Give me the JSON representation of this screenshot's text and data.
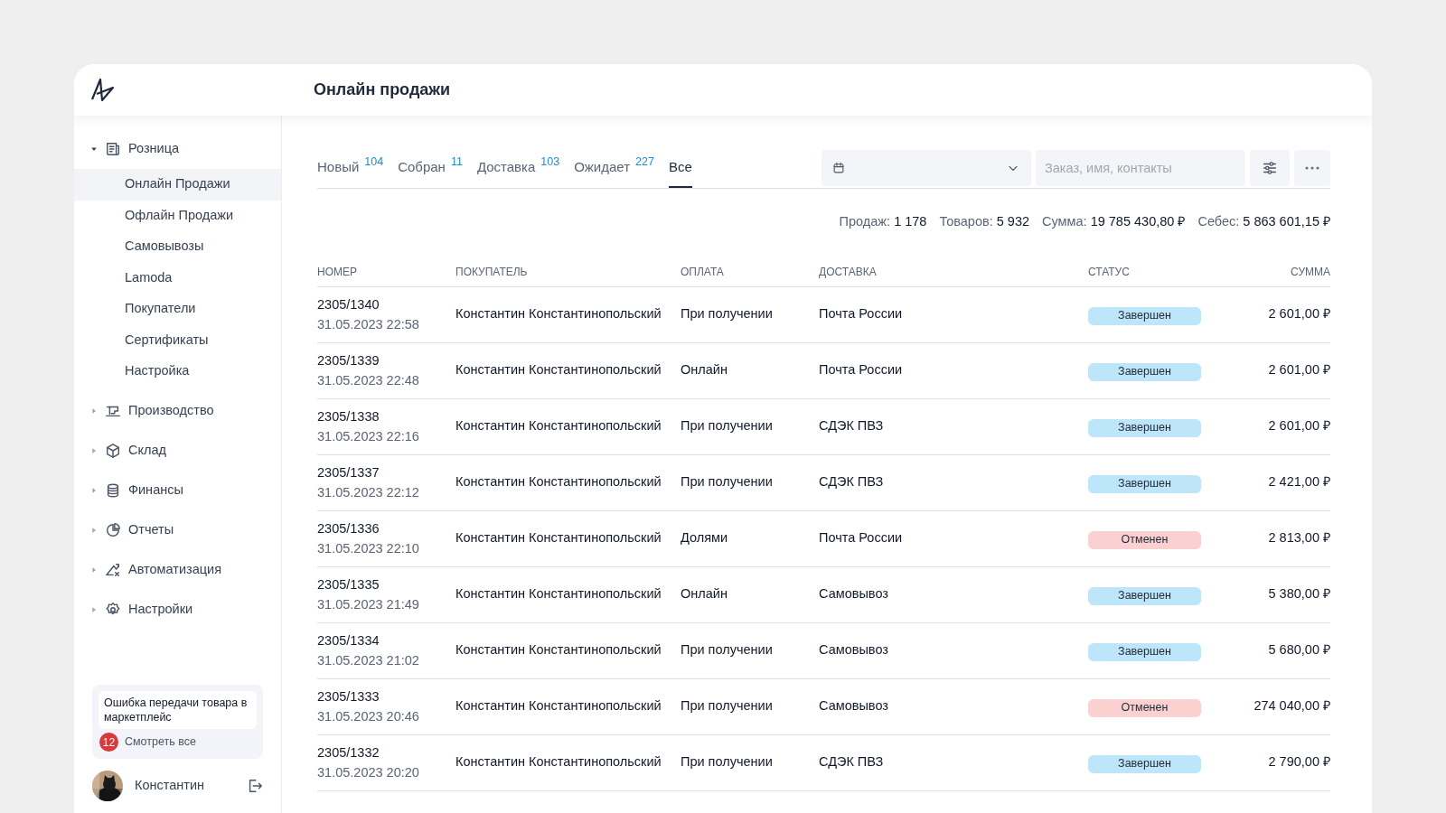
{
  "header": {
    "title": "Онлайн продажи"
  },
  "sidebar": {
    "items": [
      {
        "label": "Розница",
        "expanded": true,
        "children": [
          {
            "label": "Онлайн Продажи",
            "selected": true
          },
          {
            "label": "Офлайн Продажи",
            "selected": false
          },
          {
            "label": "Самовывозы",
            "selected": false
          },
          {
            "label": "Lamoda",
            "selected": false
          },
          {
            "label": "Покупатели",
            "selected": false
          },
          {
            "label": "Сертификаты",
            "selected": false
          },
          {
            "label": "Настройка",
            "selected": false
          }
        ]
      },
      {
        "label": "Производство",
        "expanded": false
      },
      {
        "label": "Склад",
        "expanded": false
      },
      {
        "label": "Финансы",
        "expanded": false
      },
      {
        "label": "Отчеты",
        "expanded": false
      },
      {
        "label": "Автоматизация",
        "expanded": false
      },
      {
        "label": "Настройки",
        "expanded": false
      }
    ],
    "notice": {
      "text": "Ошибка передачи товара в маркетплейс",
      "count": "12",
      "link": "Смотреть все"
    },
    "user": {
      "name": "Константин"
    }
  },
  "tabs": [
    {
      "label": "Новый",
      "count": "104",
      "selected": false
    },
    {
      "label": "Собран",
      "count": "11",
      "selected": false
    },
    {
      "label": "Доставка",
      "count": "103",
      "selected": false
    },
    {
      "label": "Ожидает",
      "count": "227",
      "selected": false
    },
    {
      "label": "Все",
      "selected": true
    }
  ],
  "search": {
    "placeholder": "Заказ, имя, контакты"
  },
  "summary": [
    {
      "label": "Продаж:",
      "value": "1 178"
    },
    {
      "label": "Товаров:",
      "value": "5 932"
    },
    {
      "label": "Сумма:",
      "value": "19 785 430,80 ₽"
    },
    {
      "label": "Себес:",
      "value": "5 863 601,15 ₽"
    }
  ],
  "table": {
    "columns": [
      "НОМЕР",
      "ПОКУПАТЕЛЬ",
      "ОПЛАТА",
      "ДОСТАВКА",
      "СТАТУС",
      "СУММА"
    ],
    "rows": [
      {
        "number": "2305/1340",
        "date": "31.05.2023 22:58",
        "buyer": "Константин Константинопольский",
        "payment": "При получении",
        "delivery": "Почта России",
        "status": "Завершен",
        "color": "#bde6fb",
        "sum": "2 601,00 ₽"
      },
      {
        "number": "2305/1339",
        "date": "31.05.2023 22:48",
        "buyer": "Константин Константинопольский",
        "payment": "Онлайн",
        "delivery": "Почта России",
        "status": "Завершен",
        "color": "#bde6fb",
        "sum": "2 601,00 ₽"
      },
      {
        "number": "2305/1338",
        "date": "31.05.2023 22:16",
        "buyer": "Константин Константинопольский",
        "payment": "При получении",
        "delivery": "СДЭК ПВЗ",
        "status": "Завершен",
        "color": "#bde6fb",
        "sum": "2 601,00 ₽"
      },
      {
        "number": "2305/1337",
        "date": "31.05.2023 22:12",
        "buyer": "Константин Константинопольский",
        "payment": "При получении",
        "delivery": "СДЭК ПВЗ",
        "status": "Завершен",
        "color": "#bde6fb",
        "sum": "2 421,00 ₽"
      },
      {
        "number": "2305/1336",
        "date": "31.05.2023 22:10",
        "buyer": "Константин Константинопольский",
        "payment": "Долями",
        "delivery": "Почта России",
        "status": "Отменен",
        "color": "#fbd0d0",
        "sum": "2 813,00 ₽"
      },
      {
        "number": "2305/1335",
        "date": "31.05.2023 21:49",
        "buyer": "Константин Константинопольский",
        "payment": "Онлайн",
        "delivery": "Самовывоз",
        "status": "Завершен",
        "color": "#bde6fb",
        "sum": "5 380,00 ₽"
      },
      {
        "number": "2305/1334",
        "date": "31.05.2023 21:02",
        "buyer": "Константин Константинопольский",
        "payment": "При получении",
        "delivery": "Самовывоз",
        "status": "Завершен",
        "color": "#bde6fb",
        "sum": "5 680,00 ₽"
      },
      {
        "number": "2305/1333",
        "date": "31.05.2023 20:46",
        "buyer": "Константин Константинопольский",
        "payment": "При получении",
        "delivery": "Самовывоз",
        "status": "Отменен",
        "color": "#fbd0d0",
        "sum": "274 040,00 ₽"
      },
      {
        "number": "2305/1332",
        "date": "31.05.2023 20:20",
        "buyer": "Константин Константинопольский",
        "payment": "При получении",
        "delivery": "СДЭК ПВЗ",
        "status": "Завершен",
        "color": "#bde6fb",
        "sum": "2 790,00 ₽"
      }
    ]
  }
}
